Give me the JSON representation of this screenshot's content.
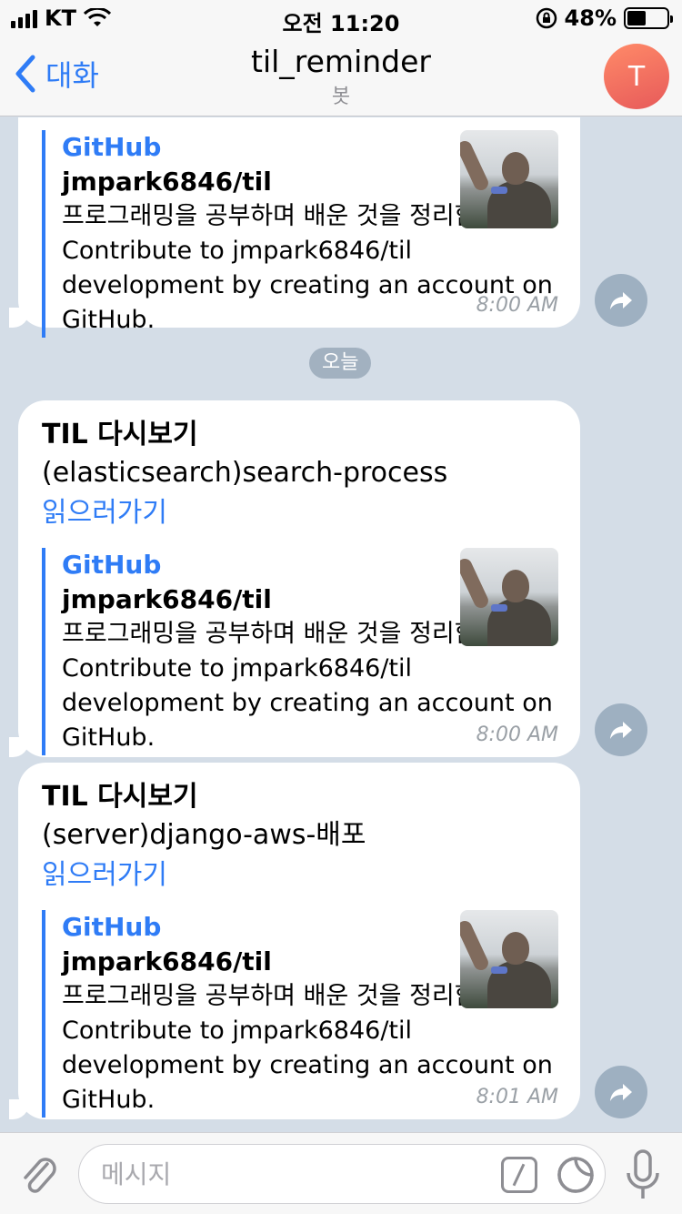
{
  "status_bar": {
    "carrier": "KT",
    "time": "오전 11:20",
    "battery": "48%",
    "battery_level": 0.48
  },
  "nav": {
    "back_label": "대화",
    "title": "til_reminder",
    "subtitle": "봇",
    "avatar_letter": "T"
  },
  "date_divider": "오늘",
  "messages": [
    {
      "preview": {
        "site": "GitHub",
        "title": "jmpark6846/til",
        "description": "프로그래밍을 공부하며 배운 것을 정리합니다. Contribute to jmpark6846/til development by creating an account on GitHub."
      },
      "time": "8:00 AM"
    },
    {
      "title": "TIL 다시보기",
      "text": "(elasticsearch)search-process",
      "link": "읽으러가기",
      "preview": {
        "site": "GitHub",
        "title": "jmpark6846/til",
        "description": "프로그래밍을 공부하며 배운 것을 정리합니다. Contribute to jmpark6846/til development by creating an account on GitHub."
      },
      "time": "8:00 AM"
    },
    {
      "title": "TIL 다시보기",
      "text": "(server)django-aws-배포",
      "link": "읽으러가기",
      "preview": {
        "site": "GitHub",
        "title": "jmpark6846/til",
        "description": "프로그래밍을 공부하며 배운 것을 정리합니다. Contribute to jmpark6846/til development by creating an account on GitHub."
      },
      "time": "8:01 AM"
    }
  ],
  "input": {
    "placeholder": "메시지"
  },
  "colors": {
    "accent": "#2f7cf6",
    "avatar_gradient_start": "#ff8a68",
    "avatar_gradient_end": "#e75a5a",
    "chat_background": "#d4dde7"
  }
}
